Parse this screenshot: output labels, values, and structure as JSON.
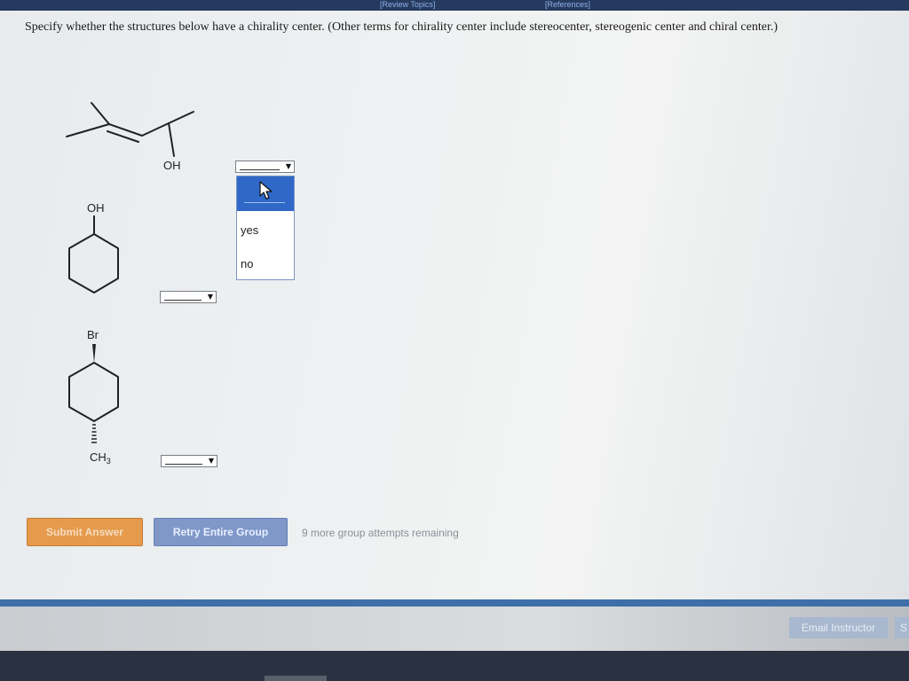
{
  "topbar": {
    "review_topics": "[Review Topics]",
    "references": "[References]"
  },
  "question": {
    "text": "Specify whether the structures below have a chirality center. (Other terms for chirality center include stereocenter, stereogenic center and chiral center.)"
  },
  "structures": {
    "s1_label": "OH",
    "s2_label": "OH",
    "s3_top": "Br",
    "s3_bottom": "CH",
    "s3_sub": "3"
  },
  "dropdown": {
    "options": [
      "yes",
      "no"
    ]
  },
  "actions": {
    "submit_label": "Submit Answer",
    "retry_label": "Retry Entire Group",
    "attempts_text": "9 more group attempts remaining"
  },
  "footer": {
    "email_label": "Email Instructor",
    "edge_label": "S"
  },
  "colors": {
    "submit_bg": "#e59a4c",
    "retry_bg": "#7f98c8",
    "dropdown_highlight": "#2f68c7",
    "divider": "#3f6fa8"
  }
}
